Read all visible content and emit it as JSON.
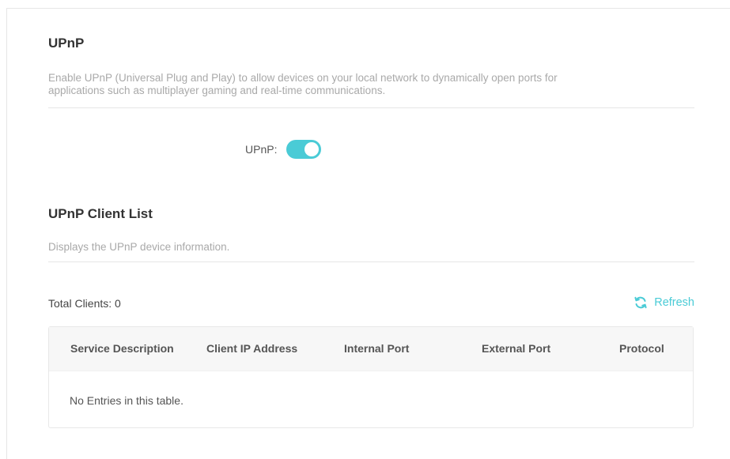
{
  "upnp": {
    "title": "UPnP",
    "description_line1": "Enable UPnP (Universal Plug and Play) to allow devices on your local network to dynamically open ports for",
    "description_line2": "applications such as multiplayer gaming and real-time communications.",
    "toggle_label": "UPnP:",
    "toggle_state": "on",
    "accent_color": "#4acbd6"
  },
  "client_list": {
    "title": "UPnP Client List",
    "description": "Displays the UPnP device information.",
    "total_label": "Total Clients: 0",
    "refresh_label": "Refresh",
    "refresh_icon": "refresh-icon",
    "table": {
      "columns": [
        "Service Description",
        "Client IP Address",
        "Internal Port",
        "External Port",
        "Protocol"
      ],
      "rows": [],
      "empty_message": "No Entries in this table."
    }
  }
}
